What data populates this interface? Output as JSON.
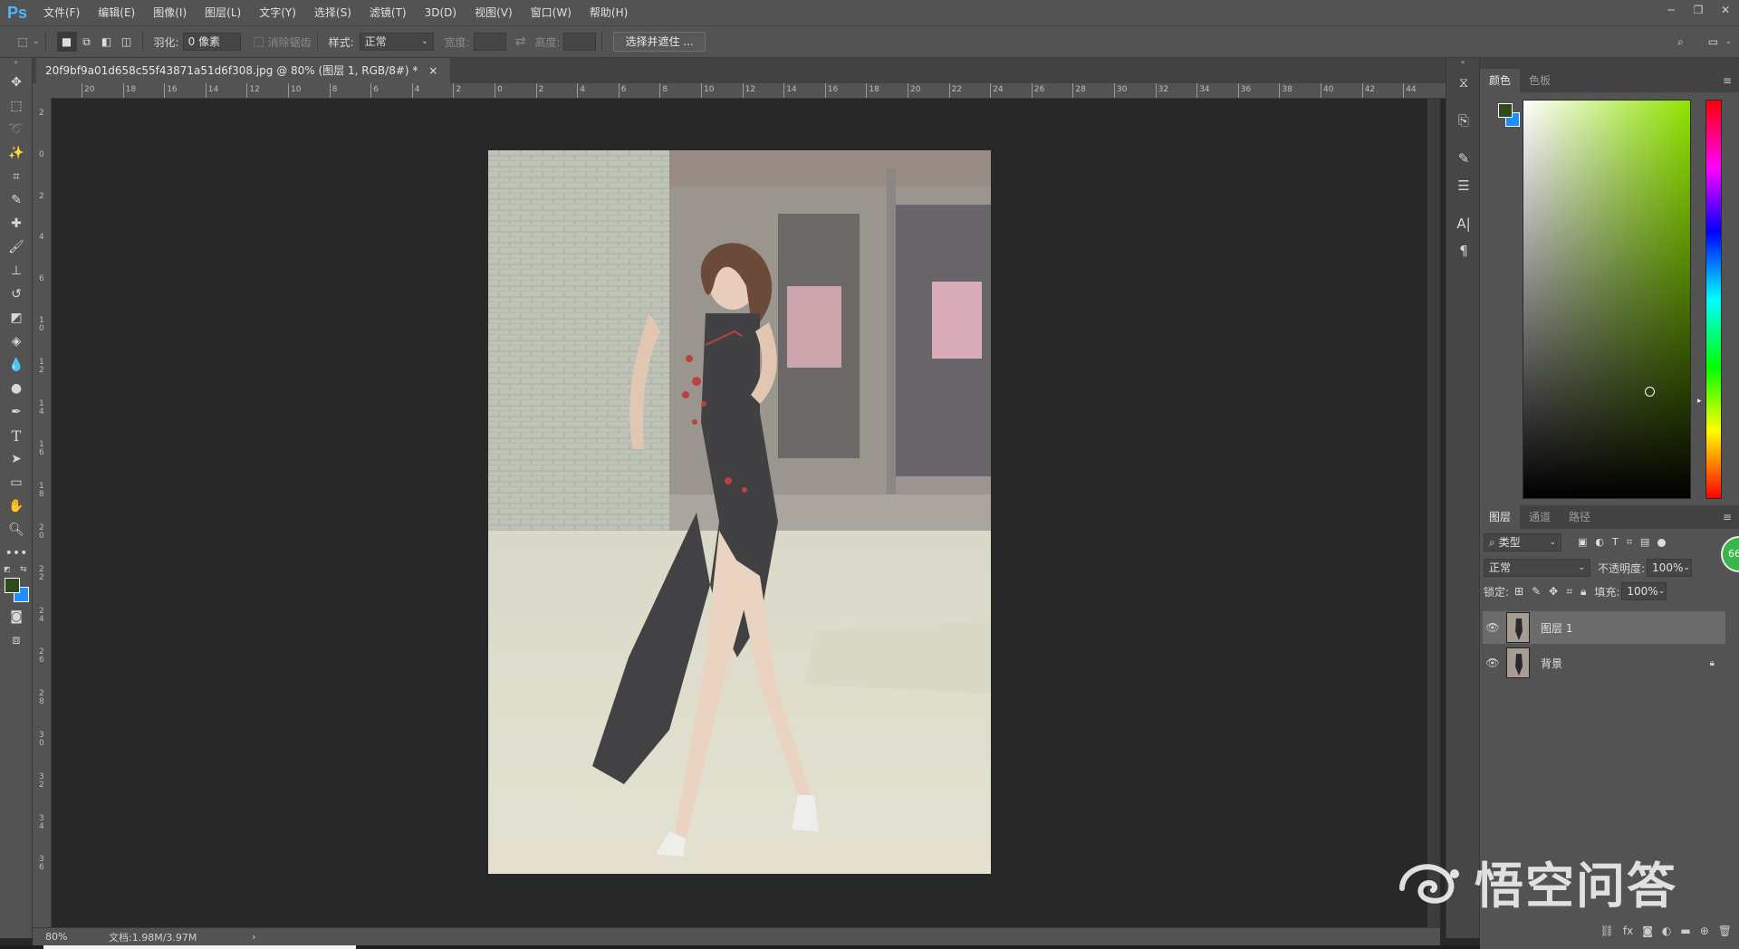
{
  "app": {
    "logo": "Ps"
  },
  "menu": [
    "文件(F)",
    "编辑(E)",
    "图像(I)",
    "图层(L)",
    "文字(Y)",
    "选择(S)",
    "滤镜(T)",
    "3D(D)",
    "视图(V)",
    "窗口(W)",
    "帮助(H)"
  ],
  "options": {
    "feather_label": "羽化:",
    "feather_value": "0 像素",
    "antialias_label": "消除锯齿",
    "style_label": "样式:",
    "style_value": "正常",
    "width_label": "宽度:",
    "height_label": "高度:",
    "select_mask_button": "选择并遮住 ..."
  },
  "document": {
    "tab_title": "20f9bf9a01d658c55f43871a51d6f308.jpg @ 80% (图层 1, RGB/8#) *",
    "close_glyph": "×"
  },
  "ruler": {
    "h_ticks": [
      "20",
      "18",
      "16",
      "14",
      "12",
      "10",
      "8",
      "6",
      "4",
      "2",
      "0",
      "2",
      "4",
      "6",
      "8",
      "10",
      "12",
      "14",
      "16",
      "18",
      "20",
      "22",
      "24",
      "26",
      "28",
      "30",
      "32",
      "34",
      "36",
      "38",
      "40",
      "42",
      "44"
    ],
    "v_ticks": [
      "2",
      "0",
      "2",
      "4",
      "6",
      "1 0",
      "1 2",
      "1 4",
      "1 6",
      "1 8",
      "2 0",
      "2 2",
      "2 4",
      "2 6",
      "2 8",
      "3 0",
      "3 2",
      "3 4",
      "3 6"
    ]
  },
  "status": {
    "zoom": "80%",
    "doc_info": "文档:1.98M/3.97M",
    "arrow": "›"
  },
  "color_panel": {
    "tabs": [
      "颜色",
      "色板"
    ],
    "foreground": "#2e4a1a",
    "background": "#1e90ff",
    "hue_color": "#8fe300"
  },
  "layers_panel": {
    "tabs": [
      "图层",
      "通道",
      "路径"
    ],
    "filter_label": "类型",
    "blend_mode": "正常",
    "opacity_label": "不透明度:",
    "opacity_value": "100%",
    "lock_label": "锁定:",
    "fill_label": "填充:",
    "fill_value": "100%",
    "layers": [
      {
        "name": "图层 1",
        "selected": true,
        "locked": false
      },
      {
        "name": "背景",
        "selected": false,
        "locked": true
      }
    ],
    "badge": "66"
  },
  "watermark": {
    "text": "悟空问答"
  }
}
